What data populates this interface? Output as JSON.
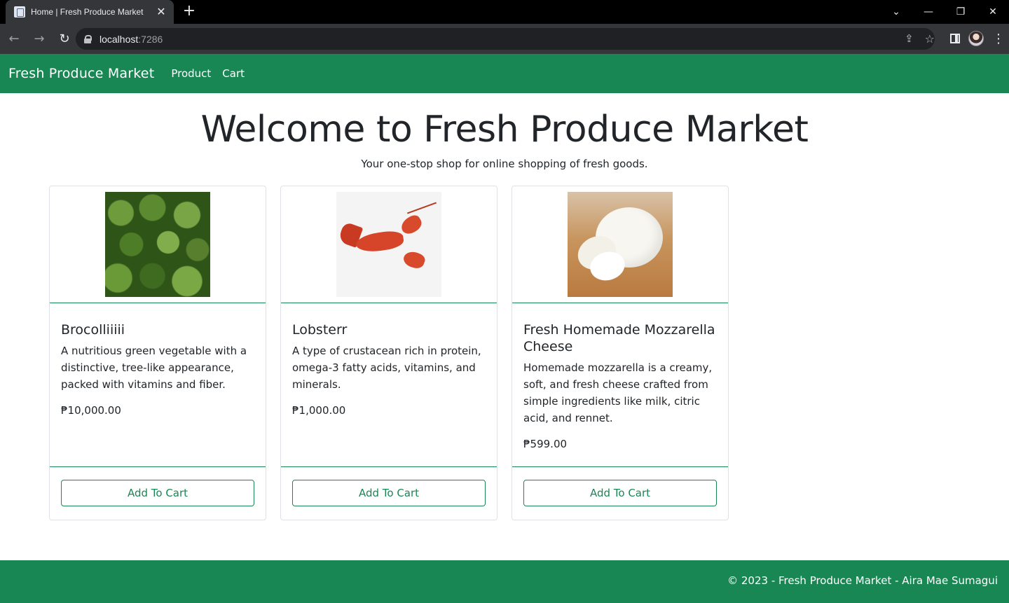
{
  "browser": {
    "tab_title": "Home | Fresh Produce Market",
    "url_host": "localhost",
    "url_port": ":7286"
  },
  "navbar": {
    "brand": "Fresh Produce Market",
    "links": [
      "Product",
      "Cart"
    ]
  },
  "hero": {
    "title": "Welcome to Fresh Produce Market",
    "tagline": "Your one-stop shop for online shopping of fresh goods."
  },
  "products": [
    {
      "name": "Brocolliiiii",
      "description": "A nutritious green vegetable with a distinctive, tree-like appearance, packed with vitamins and fiber.",
      "price": "₱10,000.00",
      "button": "Add To Cart",
      "image_icon": "broccoli-image"
    },
    {
      "name": "Lobsterr",
      "description": "A type of crustacean rich in protein, omega-3 fatty acids, vitamins, and minerals.",
      "price": "₱1,000.00",
      "button": "Add To Cart",
      "image_icon": "lobster-image"
    },
    {
      "name": "Fresh Homemade Mozzarella Cheese",
      "description": "Homemade mozzarella is a creamy, soft, and fresh cheese crafted from simple ingredients like milk, citric acid, and rennet.",
      "price": "₱599.00",
      "button": "Add To Cart",
      "image_icon": "mozzarella-image"
    }
  ],
  "footer": {
    "text": "© 2023 - Fresh Produce Market - Aira Mae Sumagui"
  },
  "colors": {
    "primary": "#198754",
    "browser_dark": "#35363a"
  }
}
